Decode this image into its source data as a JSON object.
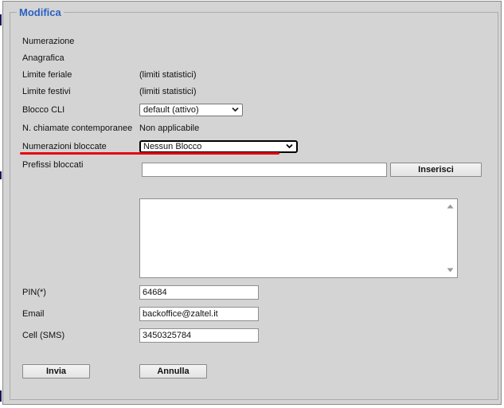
{
  "legend": "Modifica",
  "rows": {
    "numerazione": {
      "label": "Numerazione"
    },
    "anagrafica": {
      "label": "Anagrafica"
    },
    "limite_feriale": {
      "label": "Limite feriale",
      "value": "(limiti statistici)"
    },
    "limite_festivi": {
      "label": "Limite festivi",
      "value": "(limiti statistici)"
    },
    "blocco_cli": {
      "label": "Blocco CLI",
      "selected": "default (attivo)"
    },
    "chiamate": {
      "label": "N. chiamate contemporanee",
      "value": "Non applicabile"
    },
    "numerazioni_bloccate": {
      "label": "Numerazioni bloccate",
      "selected": "Nessun Blocco"
    },
    "prefissi": {
      "label": "Prefissi bloccati",
      "input_value": "",
      "button": "Inserisci",
      "list_value": ""
    },
    "pin": {
      "label": "PIN(*)",
      "value": "64684"
    },
    "email": {
      "label": "Email",
      "value": "backoffice@zaltel.it"
    },
    "cell": {
      "label": "Cell (SMS)",
      "value": "3450325784"
    }
  },
  "actions": {
    "submit": "Invia",
    "cancel": "Annulla"
  },
  "colors": {
    "legend": "#2a62c0",
    "highlight_underline": "#e30613",
    "panel": "#d4d4d4"
  }
}
